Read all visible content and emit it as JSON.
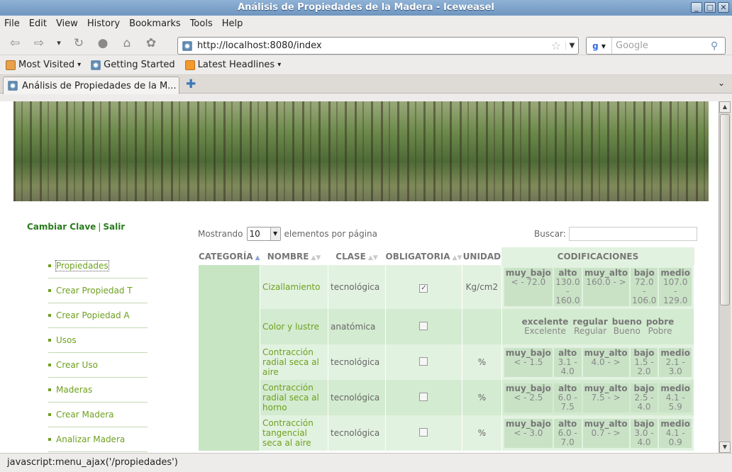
{
  "window": {
    "title": "Análisis de Propiedades de la Madera - Iceweasel",
    "buttons": [
      "_",
      "□",
      "✕"
    ]
  },
  "menubar": [
    "File",
    "Edit",
    "View",
    "History",
    "Bookmarks",
    "Tools",
    "Help"
  ],
  "address": {
    "url": "http://localhost:8080/index"
  },
  "searchbar": {
    "placeholder": "Google"
  },
  "bookmarks": [
    "Most Visited",
    "Getting Started",
    "Latest Headlines"
  ],
  "tab": {
    "title": "Análisis de Propiedades de la M..."
  },
  "status": "javascript:menu_ajax('/propiedades')",
  "userlinks": {
    "change": "Cambiar Clave",
    "sep": "|",
    "logout": "Salir"
  },
  "sidemenu": [
    "Propiedades",
    "Crear Propiedad T",
    "Crear Popiedad A",
    "Usos",
    "Crear Uso",
    "Maderas",
    "Crear Madera",
    "Analizar Madera"
  ],
  "datatable": {
    "showing": "Mostrando",
    "page_size": "10",
    "per_page": "elementos por página",
    "search_label": "Buscar:",
    "headers": [
      "CATEGORÍA",
      "NOMBRE",
      "CLASE",
      "OBLIGATORIA",
      "UNIDAD",
      "CODIFICACIONES"
    ],
    "rows": [
      {
        "nombre": "Cizallamiento",
        "clase": "tecnológica",
        "obligatoria": true,
        "unidad": "Kg/cm2",
        "codes": [
          {
            "k": "muy_bajo",
            "v": "< - 72.0"
          },
          {
            "k": "alto",
            "v": "130.0 - 160.0"
          },
          {
            "k": "muy_alto",
            "v": "160.0 - >"
          },
          {
            "k": "bajo",
            "v": "72.0 - 106.0"
          },
          {
            "k": "medio",
            "v": "107.0 - 129.0"
          }
        ]
      },
      {
        "nombre": "Color y lustre",
        "clase": "anatómica",
        "obligatoria": false,
        "unidad": "",
        "codes": [
          {
            "k": "excelente",
            "v": "Excelente"
          },
          {
            "k": "regular",
            "v": "Regular"
          },
          {
            "k": "bueno",
            "v": "Bueno"
          },
          {
            "k": "pobre",
            "v": "Pobre"
          }
        ]
      },
      {
        "nombre": "Contracción radial seca al aire",
        "clase": "tecnológica",
        "obligatoria": false,
        "unidad": "%",
        "codes": [
          {
            "k": "muy_bajo",
            "v": "< - 1.5"
          },
          {
            "k": "alto",
            "v": "3.1 - 4.0"
          },
          {
            "k": "muy_alto",
            "v": "4.0 - >"
          },
          {
            "k": "bajo",
            "v": "1.5 - 2.0"
          },
          {
            "k": "medio",
            "v": "2.1 - 3.0"
          }
        ]
      },
      {
        "nombre": "Contracción radial seca al horno",
        "clase": "tecnológica",
        "obligatoria": false,
        "unidad": "%",
        "codes": [
          {
            "k": "muy_bajo",
            "v": "< - 2.5"
          },
          {
            "k": "alto",
            "v": "6.0 - 7.5"
          },
          {
            "k": "muy_alto",
            "v": "7.5 - >"
          },
          {
            "k": "bajo",
            "v": "2.5 - 4.0"
          },
          {
            "k": "medio",
            "v": "4.1 - 5.9"
          }
        ]
      },
      {
        "nombre": "Contracción tangencial seca al aire",
        "clase": "tecnológica",
        "obligatoria": false,
        "unidad": "%",
        "codes": [
          {
            "k": "muy_bajo",
            "v": "< - 3.0"
          },
          {
            "k": "alto",
            "v": "6.0 - 7.0"
          },
          {
            "k": "muy_alto",
            "v": "0.7 - >"
          },
          {
            "k": "bajo",
            "v": "3.0 - 4.0"
          },
          {
            "k": "medio",
            "v": "4.1 - 0.9"
          }
        ]
      }
    ]
  }
}
